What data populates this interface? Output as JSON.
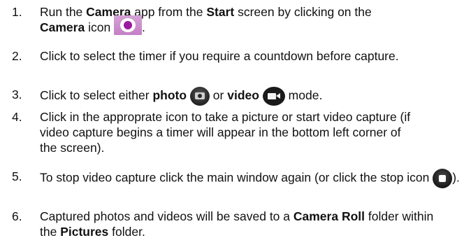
{
  "steps": [
    {
      "number": "1.",
      "parts": {
        "a": "Run the ",
        "b": "Camera",
        "c": " app from the ",
        "d": "Start",
        "e": " screen by clicking on the ",
        "f": "Camera",
        "g": " icon ",
        "h": "."
      },
      "icon": "camera-app-icon"
    },
    {
      "number": "2.",
      "text": "Click to select the timer if you require a countdown before capture."
    },
    {
      "number": "3.",
      "parts": {
        "a": "Click to select either ",
        "b": "photo",
        "c": " or ",
        "d": "video",
        "e": " mode."
      },
      "icons": [
        "photo-mode-icon",
        "video-mode-icon"
      ]
    },
    {
      "number": "4.",
      "text": "Click in the approprate icon to take a picture or start video capture (if video capture begins a timer will appear in the bottom left corner of the screen)."
    },
    {
      "number": "5.",
      "parts": {
        "a": "To stop video capture click the main window again (or click the stop icon ",
        "b": ")."
      },
      "icon": "stop-icon"
    },
    {
      "number": "6.",
      "parts": {
        "a": "Captured photos and videos will be saved to a ",
        "b": "Camera Roll",
        "c": " folder within the ",
        "d": "Pictures",
        "e": " folder."
      }
    }
  ],
  "colors": {
    "text": "#111111",
    "camera_icon_accent": "#9b1aa0",
    "camera_icon_tile": "#c47fc6",
    "dark_icon": "#1a1a1a"
  }
}
